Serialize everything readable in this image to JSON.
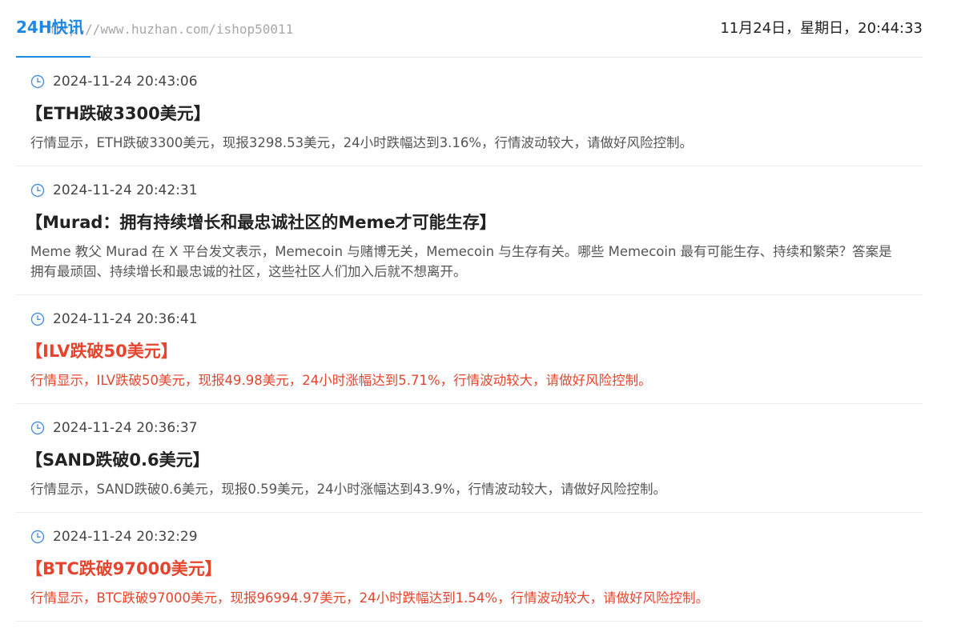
{
  "header": {
    "tab_label": "24H快讯",
    "watermark": "http://www.huzhan.com/ishop50011",
    "datetime": "11月24日，星期日，20:44:33"
  },
  "feed": [
    {
      "time": "2024-11-24 20:43:06",
      "title": "【ETH跌破3300美元】",
      "body": "行情显示，ETH跌破3300美元，现报3298.53美元，24小时跌幅达到3.16%，行情波动较大，请做好风险控制。",
      "highlight": false
    },
    {
      "time": "2024-11-24 20:42:31",
      "title": "【Murad：拥有持续增长和最忠诚社区的Meme才可能生存】",
      "body": "Meme 教父 Murad 在 X 平台发文表示，Memecoin 与赌博无关，Memecoin 与生存有关。哪些 Memecoin 最有可能生存、持续和繁荣？答案是拥有最顽固、持续增长和最忠诚的社区，这些社区人们加入后就不想离开。",
      "highlight": false
    },
    {
      "time": "2024-11-24 20:36:41",
      "title": "【ILV跌破50美元】",
      "body": "行情显示，ILV跌破50美元，现报49.98美元，24小时涨幅达到5.71%，行情波动较大，请做好风险控制。",
      "highlight": true
    },
    {
      "time": "2024-11-24 20:36:37",
      "title": "【SAND跌破0.6美元】",
      "body": "行情显示，SAND跌破0.6美元，现报0.59美元，24小时涨幅达到43.9%，行情波动较大，请做好风险控制。",
      "highlight": false
    },
    {
      "time": "2024-11-24 20:32:29",
      "title": "【BTC跌破97000美元】",
      "body": "行情显示，BTC跌破97000美元，现报96994.97美元，24小时跌幅达到1.54%，行情波动较大，请做好风险控制。",
      "highlight": true
    }
  ],
  "colors": {
    "accent": "#1e88e5",
    "highlight": "#e5452f",
    "clock_icon": "#4a90d9"
  },
  "icons": {
    "time": "clock-icon"
  }
}
